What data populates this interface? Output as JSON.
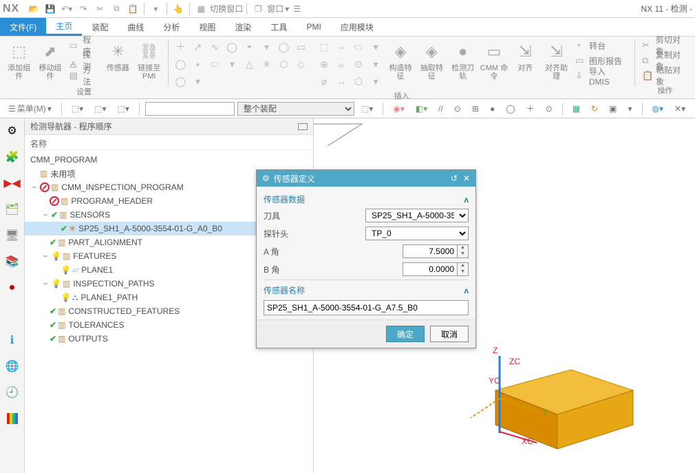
{
  "app": {
    "logo": "NX",
    "title": "NX 11 - 检测 -"
  },
  "qat": {
    "switch_window": "切换窗口",
    "window": "窗口"
  },
  "tabs": {
    "file": "文件(F)",
    "home": "主页",
    "assembly": "装配",
    "curve": "曲线",
    "analysis": "分析",
    "view": "视图",
    "render": "渲染",
    "tool": "工具",
    "pmi": "PMI",
    "app": "应用模块"
  },
  "ribbon": {
    "g1": {
      "name": "设置",
      "add": "添加组件",
      "move": "移动组件",
      "program": "程序",
      "probe": "探测",
      "method": "方法",
      "sensor": "传感器",
      "link": "链接至 PMI"
    },
    "g2": {
      "name": "插入",
      "build": "构造特征",
      "extract": "抽取特征",
      "check": "检测刀轨",
      "cmm": "CMM 命令",
      "align": "对齐",
      "align_help": "对齐助理",
      "side": [
        {
          "icon": "◔",
          "label": "转台"
        },
        {
          "icon": "▭",
          "label": "图形报告"
        },
        {
          "icon": "⇩",
          "label": "导入 DMIS"
        }
      ]
    },
    "g3": {
      "name": "操作",
      "cut": "剪切对象",
      "copy": "复制对象",
      "paste": "粘贴对象"
    }
  },
  "menubar": {
    "menu": "菜单(M)",
    "assembly_sel": "整个装配"
  },
  "navigator": {
    "title": "检测导航器 - 程序顺序",
    "col": "名称",
    "root": "CMM_PROGRAM",
    "unused": "未用项",
    "prog": "CMM_INSPECTION_PROGRAM",
    "items": {
      "header": "PROGRAM_HEADER",
      "sensors": "SENSORS",
      "sensor0": "SP25_SH1_A-5000-3554-01-G_A0_B0",
      "align": "PART_ALIGNMENT",
      "features": "FEATURES",
      "plane1": "PLANE1",
      "paths": "INSPECTION_PATHS",
      "plane1_path": "PLANE1_PATH",
      "constructed": "CONSTRUCTED_FEATURES",
      "tolerances": "TOLERANCES",
      "outputs": "OUTPUTS"
    }
  },
  "dialog": {
    "title": "传感器定义",
    "sec_data": "传感器数据",
    "tool": "刀具",
    "tool_val": "SP25_SH1_A-5000-35",
    "probe": "探针头",
    "probe_val": "TP_0",
    "aang": "A 角",
    "a_val": "7.5000",
    "bang": "B 角",
    "b_val": "0.0000",
    "sec_name": "传感器名称",
    "name_val": "SP25_SH1_A-5000-3554-01-G_A7.5_B0",
    "ok": "确定",
    "cancel": "取消"
  },
  "triad": {
    "x": "XC",
    "y": "YC",
    "z": "ZC",
    "zabs": "Z",
    "yabs": "Y"
  }
}
